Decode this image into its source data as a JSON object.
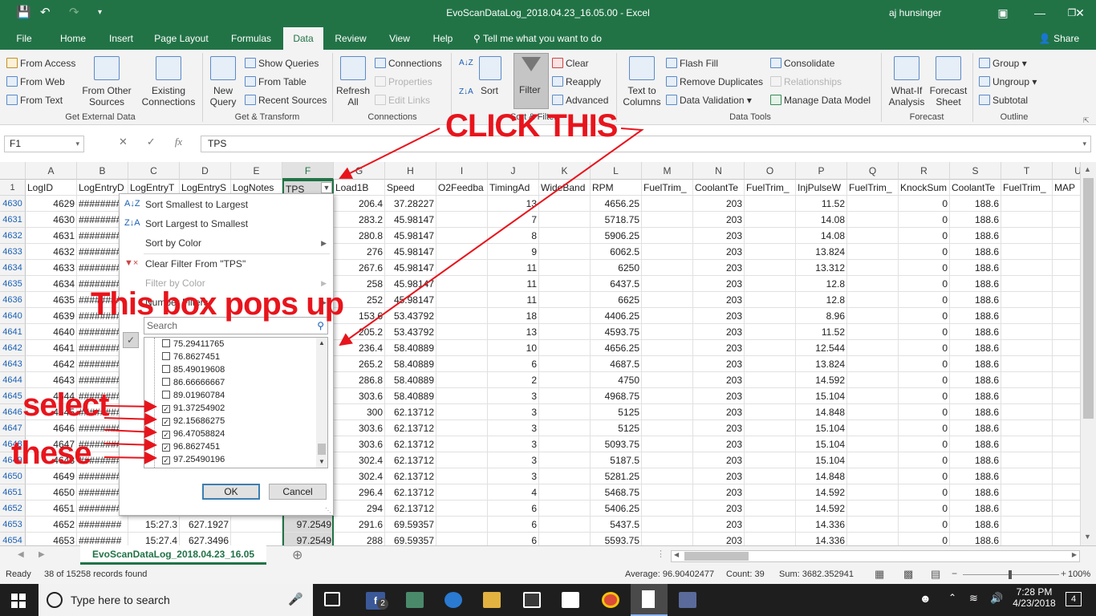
{
  "title_bar": {
    "window_title": "EvoScanDataLog_2018.04.23_16.05.00  -  Excel",
    "user": "aj hunsinger"
  },
  "tabs": [
    "File",
    "Home",
    "Insert",
    "Page Layout",
    "Formulas",
    "Data",
    "Review",
    "View",
    "Help"
  ],
  "tell_me": "Tell me what you want to do",
  "share": "Share",
  "ribbon": {
    "get_external": {
      "from_access": "From Access",
      "from_web": "From Web",
      "from_text": "From Text",
      "from_other_1": "From Other",
      "from_other_2": "Sources",
      "existing_1": "Existing",
      "existing_2": "Connections",
      "label": "Get External Data"
    },
    "get_transform": {
      "new_1": "New",
      "new_2": "Query",
      "show_queries": "Show Queries",
      "from_table": "From Table",
      "recent_sources": "Recent Sources",
      "label": "Get & Transform"
    },
    "connections": {
      "refresh_1": "Refresh",
      "refresh_2": "All",
      "connections": "Connections",
      "properties": "Properties",
      "edit_links": "Edit Links",
      "label": "Connections"
    },
    "sort_filter": {
      "sort": "Sort",
      "filter": "Filter",
      "clear": "Clear",
      "reapply": "Reapply",
      "advanced": "Advanced",
      "label": "Sort & Filter"
    },
    "data_tools": {
      "text_1": "Text to",
      "text_2": "Columns",
      "flash_fill": "Flash Fill",
      "remove_dup": "Remove Duplicates",
      "data_validation": "Data Validation",
      "consolidate": "Consolidate",
      "relationships": "Relationships",
      "manage_model": "Manage Data Model",
      "label": "Data Tools"
    },
    "forecast": {
      "whatif_1": "What-If",
      "whatif_2": "Analysis",
      "forecast_1": "Forecast",
      "forecast_2": "Sheet",
      "label": "Forecast"
    },
    "outline": {
      "group": "Group",
      "ungroup": "Ungroup",
      "subtotal": "Subtotal",
      "label": "Outline"
    }
  },
  "formula_bar": {
    "name_box": "F1",
    "content": "TPS"
  },
  "columns": [
    "A",
    "B",
    "C",
    "D",
    "E",
    "F",
    "G",
    "H",
    "I",
    "J",
    "K",
    "L",
    "M",
    "N",
    "O",
    "P",
    "Q",
    "R",
    "S",
    "T",
    "U"
  ],
  "header_row": {
    "row": "1",
    "cells": [
      "LogID",
      "LogEntryD",
      "LogEntryT",
      "LogEntryS",
      "LogNotes",
      "TPS",
      "Load1B",
      "Speed",
      "O2Feedba",
      "TimingAd",
      "WideBand",
      "RPM",
      "FuelTrim_",
      "CoolantTe",
      "FuelTrim_",
      "InjPulseW",
      "FuelTrim_",
      "KnockSum",
      "CoolantTe",
      "FuelTrim_",
      "MAP"
    ]
  },
  "rows": [
    {
      "row": "4630",
      "a": "4629",
      "b": "########",
      "g": "206.4",
      "h": "37.28227",
      "j": "13",
      "l": "4656.25",
      "n": "203",
      "p": "11.52",
      "r": "0",
      "s": "188.6"
    },
    {
      "row": "4631",
      "a": "4630",
      "b": "########",
      "g": "283.2",
      "h": "45.98147",
      "j": "7",
      "l": "5718.75",
      "n": "203",
      "p": "14.08",
      "r": "0",
      "s": "188.6"
    },
    {
      "row": "4632",
      "a": "4631",
      "b": "########",
      "g": "280.8",
      "h": "45.98147",
      "j": "8",
      "l": "5906.25",
      "n": "203",
      "p": "14.08",
      "r": "0",
      "s": "188.6"
    },
    {
      "row": "4633",
      "a": "4632",
      "b": "########",
      "g": "276",
      "h": "45.98147",
      "j": "9",
      "l": "6062.5",
      "n": "203",
      "p": "13.824",
      "r": "0",
      "s": "188.6"
    },
    {
      "row": "4634",
      "a": "4633",
      "b": "########",
      "g": "267.6",
      "h": "45.98147",
      "j": "11",
      "l": "6250",
      "n": "203",
      "p": "13.312",
      "r": "0",
      "s": "188.6"
    },
    {
      "row": "4635",
      "a": "4634",
      "b": "########",
      "g": "258",
      "h": "45.98147",
      "j": "11",
      "l": "6437.5",
      "n": "203",
      "p": "12.8",
      "r": "0",
      "s": "188.6"
    },
    {
      "row": "4636",
      "a": "4635",
      "b": "########",
      "g": "252",
      "h": "45.98147",
      "j": "11",
      "l": "6625",
      "n": "203",
      "p": "12.8",
      "r": "0",
      "s": "188.6"
    },
    {
      "row": "4640",
      "a": "4639",
      "b": "########",
      "g": "153.6",
      "h": "53.43792",
      "j": "18",
      "l": "4406.25",
      "n": "203",
      "p": "8.96",
      "r": "0",
      "s": "188.6"
    },
    {
      "row": "4641",
      "a": "4640",
      "b": "########",
      "g": "205.2",
      "h": "53.43792",
      "j": "13",
      "l": "4593.75",
      "n": "203",
      "p": "11.52",
      "r": "0",
      "s": "188.6"
    },
    {
      "row": "4642",
      "a": "4641",
      "b": "########",
      "g": "236.4",
      "h": "58.40889",
      "j": "10",
      "l": "4656.25",
      "n": "203",
      "p": "12.544",
      "r": "0",
      "s": "188.6"
    },
    {
      "row": "4643",
      "a": "4642",
      "b": "########",
      "g": "265.2",
      "h": "58.40889",
      "j": "6",
      "l": "4687.5",
      "n": "203",
      "p": "13.824",
      "r": "0",
      "s": "188.6"
    },
    {
      "row": "4644",
      "a": "4643",
      "b": "########",
      "g": "286.8",
      "h": "58.40889",
      "j": "2",
      "l": "4750",
      "n": "203",
      "p": "14.592",
      "r": "0",
      "s": "188.6"
    },
    {
      "row": "4645",
      "a": "4644",
      "b": "########",
      "g": "303.6",
      "h": "58.40889",
      "j": "3",
      "l": "4968.75",
      "n": "203",
      "p": "15.104",
      "r": "0",
      "s": "188.6"
    },
    {
      "row": "4646",
      "a": "4645",
      "b": "########",
      "g": "300",
      "h": "62.13712",
      "j": "3",
      "l": "5125",
      "n": "203",
      "p": "14.848",
      "r": "0",
      "s": "188.6"
    },
    {
      "row": "4647",
      "a": "4646",
      "b": "########",
      "g": "303.6",
      "h": "62.13712",
      "j": "3",
      "l": "5125",
      "n": "203",
      "p": "15.104",
      "r": "0",
      "s": "188.6"
    },
    {
      "row": "4648",
      "a": "4647",
      "b": "########",
      "g": "303.6",
      "h": "62.13712",
      "j": "3",
      "l": "5093.75",
      "n": "203",
      "p": "15.104",
      "r": "0",
      "s": "188.6"
    },
    {
      "row": "4649",
      "a": "4648",
      "b": "########",
      "g": "302.4",
      "h": "62.13712",
      "j": "3",
      "l": "5187.5",
      "n": "203",
      "p": "15.104",
      "r": "0",
      "s": "188.6"
    },
    {
      "row": "4650",
      "a": "4649",
      "b": "########",
      "g": "302.4",
      "h": "62.13712",
      "j": "3",
      "l": "5281.25",
      "n": "203",
      "p": "14.848",
      "r": "0",
      "s": "188.6"
    },
    {
      "row": "4651",
      "a": "4650",
      "b": "########",
      "g": "296.4",
      "h": "62.13712",
      "j": "4",
      "l": "5468.75",
      "n": "203",
      "p": "14.592",
      "r": "0",
      "s": "188.6"
    },
    {
      "row": "4652",
      "a": "4651",
      "b": "########",
      "g": "294",
      "h": "62.13712",
      "j": "6",
      "l": "5406.25",
      "n": "203",
      "p": "14.592",
      "r": "0",
      "s": "188.6"
    },
    {
      "row": "4653",
      "a": "4652",
      "b": "########",
      "c": "15:27.3",
      "d": "627.1927",
      "f": "97.2549",
      "g": "291.6",
      "h": "69.59357",
      "j": "6",
      "l": "5437.5",
      "n": "203",
      "p": "14.336",
      "r": "0",
      "s": "188.6"
    },
    {
      "row": "4654",
      "a": "4653",
      "b": "########",
      "c": "15:27.4",
      "d": "627.3496",
      "f": "97.2549",
      "g": "288",
      "h": "69.59357",
      "j": "6",
      "l": "5593.75",
      "n": "203",
      "p": "14.336",
      "r": "0",
      "s": "188.6"
    }
  ],
  "filter_menu": {
    "sort_asc": "Sort Smallest to Largest",
    "sort_desc": "Sort Largest to Smallest",
    "sort_color": "Sort by Color",
    "clear_filter": "Clear Filter From \"TPS\"",
    "filter_color": "Filter by Color",
    "number_filters": "Number Filters",
    "search_placeholder": "Search",
    "values": [
      {
        "label": "75.29411765",
        "checked": false
      },
      {
        "label": "76.8627451",
        "checked": false
      },
      {
        "label": "85.49019608",
        "checked": false
      },
      {
        "label": "86.66666667",
        "checked": false
      },
      {
        "label": "89.01960784",
        "checked": false
      },
      {
        "label": "91.37254902",
        "checked": true
      },
      {
        "label": "92.15686275",
        "checked": true
      },
      {
        "label": "96.47058824",
        "checked": true
      },
      {
        "label": "96.8627451",
        "checked": true
      },
      {
        "label": "97.25490196",
        "checked": true
      }
    ],
    "ok": "OK",
    "cancel": "Cancel"
  },
  "sheet_tab": "EvoScanDataLog_2018.04.23_16.05",
  "status": {
    "ready": "Ready",
    "records": "38 of 15258 records found",
    "average": "Average: 96.90402477",
    "count": "Count: 39",
    "sum": "Sum: 3682.352941",
    "zoom": "100%"
  },
  "taskbar": {
    "search": "Type here to search",
    "time": "7:28 PM",
    "date": "4/23/2018",
    "badge_fb": "2",
    "badge_notif": "4"
  },
  "annotations": {
    "click_this": "CLICK THIS",
    "box_pops": "This box pops up",
    "select": "select",
    "these": "these"
  },
  "colors": {
    "excel_green": "#217346",
    "annotation_red": "#e8141c"
  }
}
